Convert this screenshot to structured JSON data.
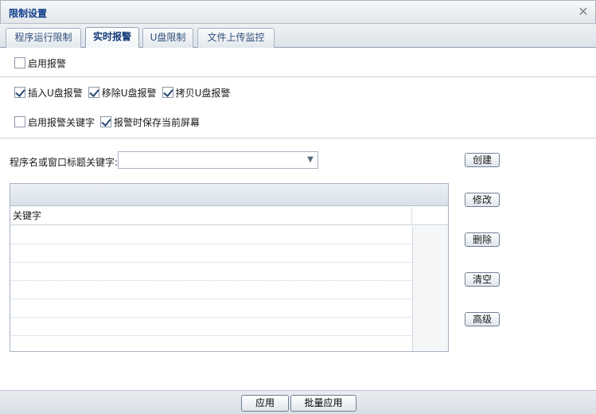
{
  "window": {
    "title": "限制设置",
    "close_symbol": "✕"
  },
  "tabs": [
    {
      "label": "程序运行限制",
      "active": false
    },
    {
      "label": "实时报警",
      "active": true
    },
    {
      "label": "U盘限制",
      "active": false
    },
    {
      "label": "文件上传监控",
      "active": false
    }
  ],
  "options": {
    "enable_alarm": {
      "label": "启用报警",
      "checked": false
    },
    "insert_usb_alarm": {
      "label": "插入U盘报警",
      "checked": true
    },
    "remove_usb_alarm": {
      "label": "移除U盘报警",
      "checked": true
    },
    "copy_usb_alarm": {
      "label": "拷贝U盘报警",
      "checked": true
    },
    "enable_keyword_alarm": {
      "label": "启用报警关键字",
      "checked": false
    },
    "save_screen_on_alarm": {
      "label": "报警时保存当前屏幕",
      "checked": true
    }
  },
  "keyword": {
    "label": "程序名或窗口标题关键字:",
    "value": ""
  },
  "table": {
    "column_header": "关键字",
    "rows": []
  },
  "side_buttons": {
    "create": "创建",
    "modify": "修改",
    "delete": "删除",
    "clear": "清空",
    "advanced": "高级"
  },
  "footer": {
    "apply": "应用",
    "batch_apply": "批量应用"
  }
}
